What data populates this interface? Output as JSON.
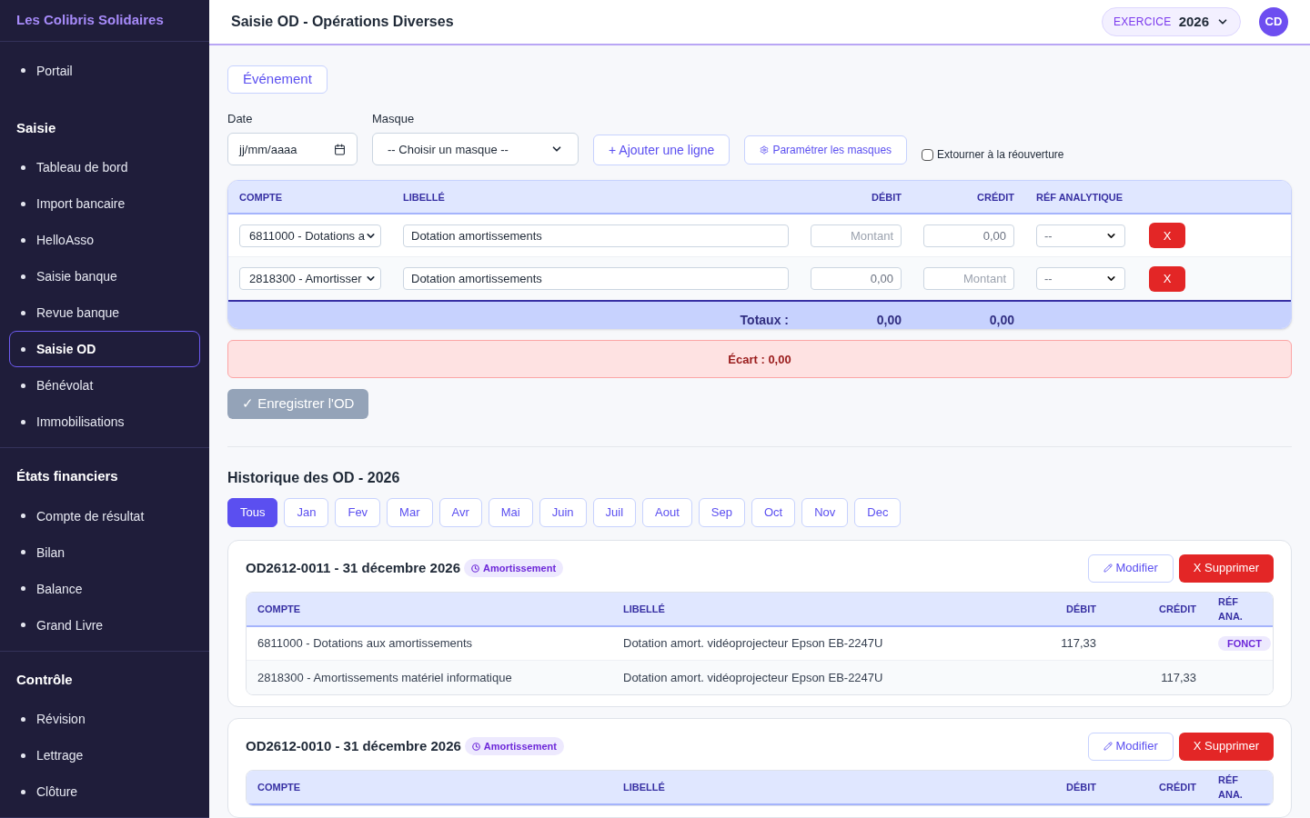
{
  "sidebar": {
    "brand": "Les Colibris Solidaires",
    "sections": [
      {
        "items": [
          {
            "label": "Portail",
            "selected": false
          }
        ]
      },
      {
        "title": "Saisie",
        "items": [
          {
            "label": "Tableau de bord",
            "selected": false
          },
          {
            "label": "Import bancaire",
            "selected": false
          },
          {
            "label": "HelloAsso",
            "selected": false
          },
          {
            "label": "Saisie banque",
            "selected": false
          },
          {
            "label": "Revue banque",
            "selected": false
          },
          {
            "label": "Saisie OD",
            "selected": true
          },
          {
            "label": "Bénévolat",
            "selected": false
          },
          {
            "label": "Immobilisations",
            "selected": false
          }
        ]
      },
      {
        "title": "États financiers",
        "items": [
          {
            "label": "Compte de résultat",
            "selected": false
          },
          {
            "label": "Bilan",
            "selected": false
          },
          {
            "label": "Balance",
            "selected": false
          },
          {
            "label": "Grand Livre",
            "selected": false
          }
        ]
      },
      {
        "title": "Contrôle",
        "items": [
          {
            "label": "Révision",
            "selected": false
          },
          {
            "label": "Lettrage",
            "selected": false
          },
          {
            "label": "Clôture",
            "selected": false
          }
        ]
      }
    ]
  },
  "header": {
    "title": "Saisie OD - Opérations Diverses",
    "exercise_label": "EXERCICE",
    "exercise_value": "2026",
    "avatar": "CD"
  },
  "form": {
    "event_button": "Événement",
    "date_label": "Date",
    "date_placeholder": "jj/mm/aaaa",
    "mask_label": "Masque",
    "mask_value": "-- Choisir un masque --",
    "add_line_button": "+ Ajouter une ligne",
    "settings_button": "Paramétrer les masques",
    "reverse_checkbox": {
      "label": "Extourner à la réouverture",
      "checked": false
    }
  },
  "entry_table": {
    "columns": [
      "COMPTE",
      "LIBELLÉ",
      "DÉBIT",
      "CRÉDIT",
      "RÉF ANALYTIQUE"
    ],
    "rows": [
      {
        "account": "6811000 - Dotations a",
        "label": "Dotation amortissements",
        "debit": {
          "placeholder": "Montant"
        },
        "credit": {
          "value": "0,00"
        },
        "ref": "--",
        "delete": "X"
      },
      {
        "account": "2818300 - Amortisser",
        "label": "Dotation amortissements",
        "debit": {
          "value": "0,00"
        },
        "credit": {
          "placeholder": "Montant"
        },
        "ref": "--",
        "delete": "X"
      }
    ],
    "totals_label": "Totaux :",
    "total_debit": "0,00",
    "total_credit": "0,00"
  },
  "gap_message": "Écart : 0,00",
  "save_button": {
    "label": "✓ Enregistrer l'OD",
    "disabled": true
  },
  "history": {
    "title": "Historique des OD - 2026",
    "months": [
      {
        "label": "Tous",
        "selected": true
      },
      {
        "label": "Jan",
        "selected": false
      },
      {
        "label": "Fev",
        "selected": false
      },
      {
        "label": "Mar",
        "selected": false
      },
      {
        "label": "Avr",
        "selected": false
      },
      {
        "label": "Mai",
        "selected": false
      },
      {
        "label": "Juin",
        "selected": false
      },
      {
        "label": "Juil",
        "selected": false
      },
      {
        "label": "Aout",
        "selected": false
      },
      {
        "label": "Sep",
        "selected": false
      },
      {
        "label": "Oct",
        "selected": false
      },
      {
        "label": "Nov",
        "selected": false
      },
      {
        "label": "Dec",
        "selected": false
      }
    ],
    "entries": [
      {
        "title": "OD2612-0011 - 31 décembre 2026",
        "tag": "Amortissement",
        "edit": "Modifier",
        "delete": "X Supprimer",
        "columns": [
          "COMPTE",
          "LIBELLÉ",
          "DÉBIT",
          "CRÉDIT",
          "RÉF ANA."
        ],
        "rows": [
          {
            "account": "6811000 - Dotations aux amortissements",
            "label": "Dotation amort. vidéoprojecteur Epson EB-2247U",
            "debit": "117,33",
            "ref": "FONCT"
          },
          {
            "account": "2818300 - Amortissements matériel informatique",
            "label": "Dotation amort. vidéoprojecteur Epson EB-2247U",
            "credit": "117,33"
          }
        ]
      },
      {
        "title": "OD2612-0010 - 31 décembre 2026",
        "tag": "Amortissement",
        "edit": "Modifier",
        "delete": "X Supprimer",
        "columns": [
          "COMPTE",
          "LIBELLÉ",
          "DÉBIT",
          "CRÉDIT",
          "RÉF ANA."
        ]
      }
    ]
  }
}
